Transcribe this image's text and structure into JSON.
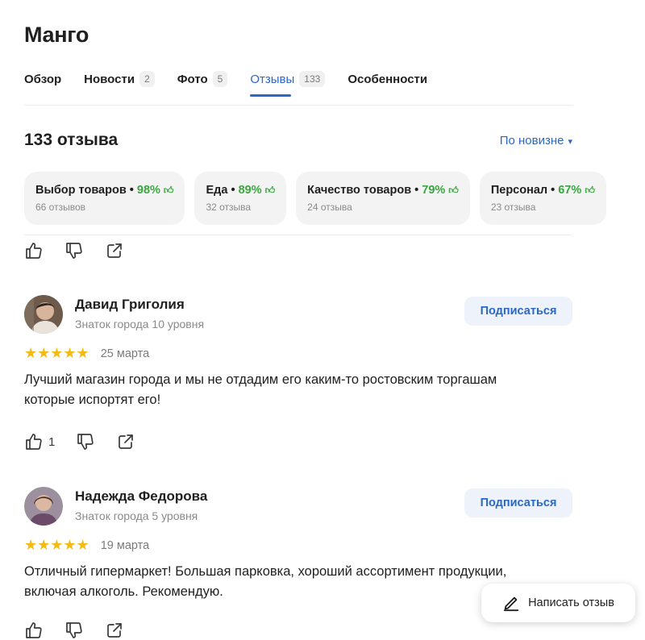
{
  "place": {
    "title": "Манго"
  },
  "tabs": [
    {
      "label": "Обзор",
      "count": null,
      "active": false
    },
    {
      "label": "Новости",
      "count": "2",
      "active": false
    },
    {
      "label": "Фото",
      "count": "5",
      "active": false
    },
    {
      "label": "Отзывы",
      "count": "133",
      "active": true
    },
    {
      "label": "Особенности",
      "count": null,
      "active": false
    }
  ],
  "reviews_header": {
    "title": "133 отзыва",
    "sort_label": "По новизне",
    "sort_caret": "▾"
  },
  "aspects": [
    {
      "name": "Выбор товаров",
      "percent": "98%",
      "reviews": "66 отзывов"
    },
    {
      "name": "Еда",
      "percent": "89%",
      "reviews": "32 отзыва"
    },
    {
      "name": "Качество товаров",
      "percent": "79%",
      "reviews": "24 отзыва"
    },
    {
      "name": "Персонал",
      "percent": "67%",
      "reviews": "23 отзыва"
    }
  ],
  "top_actions": {
    "likes": ""
  },
  "reviews": [
    {
      "author": "Давид Григолия",
      "level": "Знаток города 10 уровня",
      "subscribe_label": "Подписаться",
      "rating": 5,
      "stars": "★★★★★",
      "date": "25 марта",
      "text": "Лучший магазин города и мы не отдадим его каким-то ростовским торгашам которые испортят его!",
      "likes": "1"
    },
    {
      "author": "Надежда Федорова",
      "level": "Знаток города 5 уровня",
      "subscribe_label": "Подписаться",
      "rating": 5,
      "stars": "★★★★★",
      "date": "19 марта",
      "text": "Отличный гипермаркет! Большая парковка, хороший ассортимент продукции, включая алкоголь. Рекомендую.",
      "likes": ""
    }
  ],
  "write_review": {
    "label": "Написать отзыв"
  },
  "colors": {
    "accent": "#2b68c6",
    "positive": "#3aa640",
    "star": "#f4bb14"
  },
  "icons": {
    "like": "thumb-up-icon",
    "dislike": "thumb-down-icon",
    "share": "share-icon",
    "write": "pencil-icon"
  }
}
